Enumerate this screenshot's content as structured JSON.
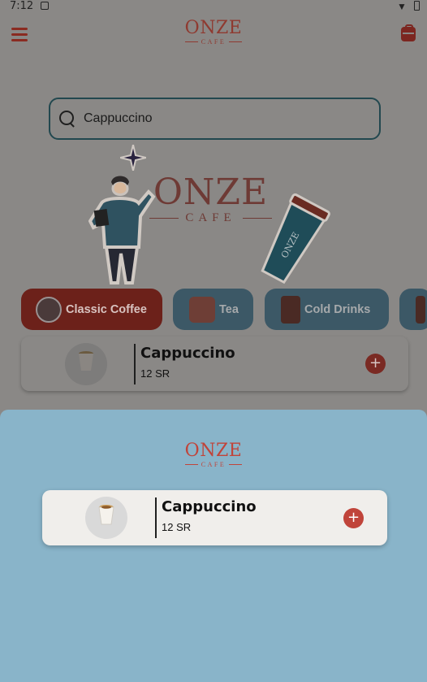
{
  "status_bar": {
    "time": "7:12"
  },
  "app_bar": {
    "logo_word": "ONZE",
    "logo_sub": "CAFE"
  },
  "search": {
    "value": "Cappuccino"
  },
  "hero": {
    "logo_word": "ONZE",
    "logo_sub": "CAFE"
  },
  "categories": [
    {
      "label": "Classic Coffee",
      "selected": true
    },
    {
      "label": "Tea",
      "selected": false
    },
    {
      "label": "Cold Drinks",
      "selected": false
    }
  ],
  "products": [
    {
      "name": "Cappuccino",
      "price": "12 SR"
    }
  ],
  "sheet": {
    "logo_word": "ONZE",
    "logo_sub": "CAFE",
    "product": {
      "name": "Cappuccino",
      "price": "12 SR",
      "add_label": "+"
    }
  },
  "colors": {
    "brand_red": "#c0443a",
    "sheet_blue": "#89b4c9",
    "search_border": "#22484f"
  }
}
